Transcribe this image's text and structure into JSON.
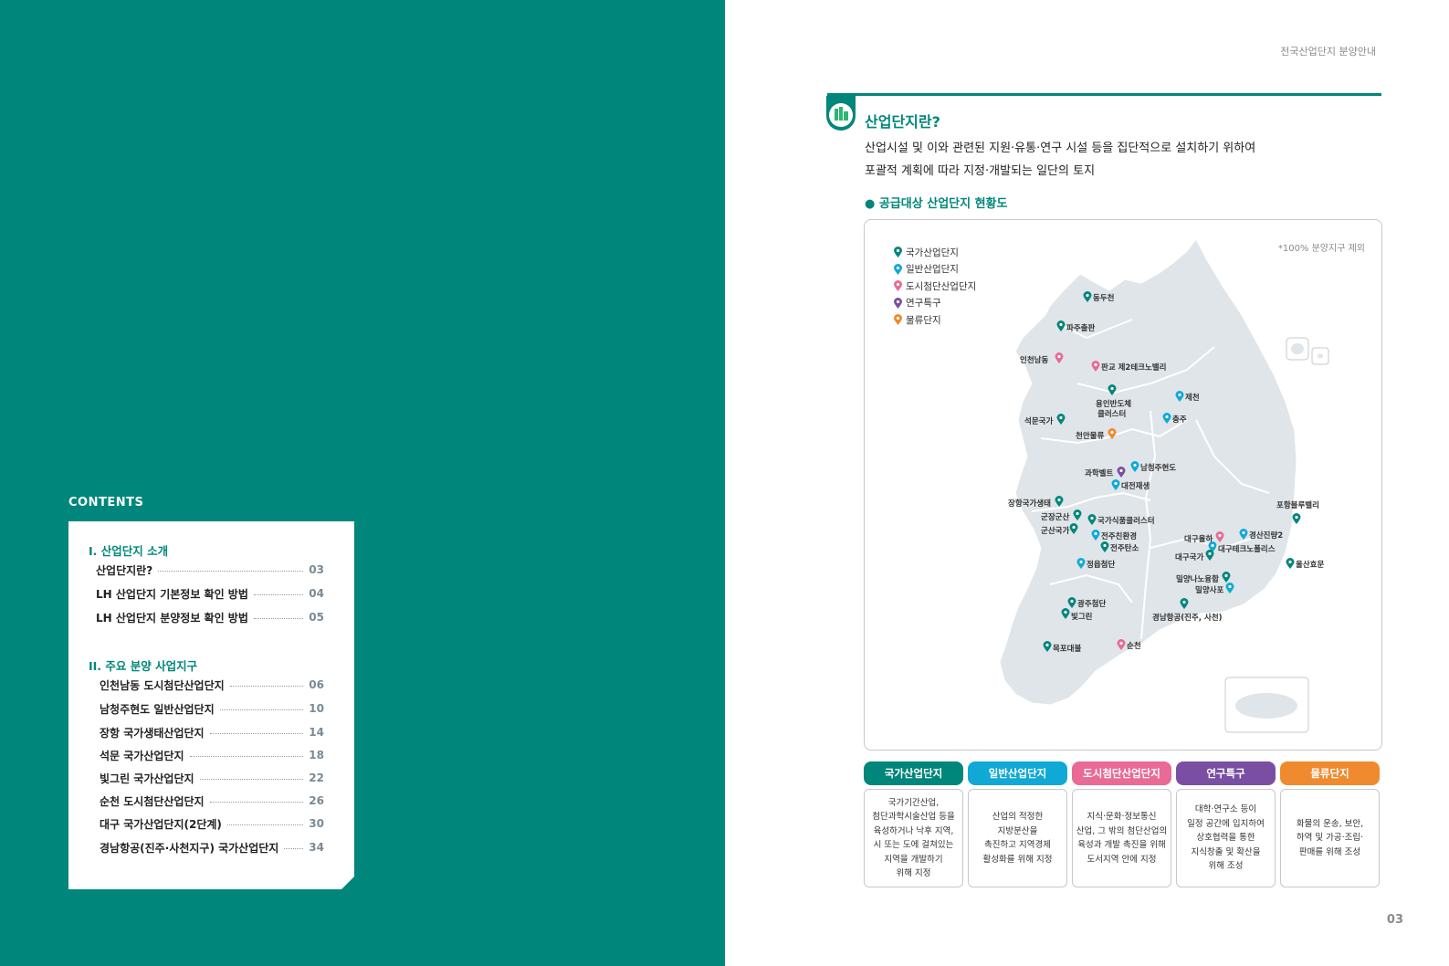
{
  "left": {
    "contents_label": "CONTENTS",
    "sections": [
      {
        "title": "I. 산업단지 소개",
        "items": [
          {
            "label": "산업단지란?",
            "page": "03"
          },
          {
            "label": "LH 산업단지 기본정보 확인 방법",
            "page": "04"
          },
          {
            "label": "LH 산업단지 분양정보 확인 방법",
            "page": "05"
          }
        ]
      },
      {
        "title": "II. 주요 분양 사업지구",
        "items": [
          {
            "label": "인천남동 도시첨단산업단지",
            "page": "06"
          },
          {
            "label": "남청주현도 일반산업단지",
            "page": "10"
          },
          {
            "label": "장항 국가생태산업단지",
            "page": "14"
          },
          {
            "label": "석문 국가산업단지",
            "page": "18"
          },
          {
            "label": "빛그린 국가산업단지",
            "page": "22"
          },
          {
            "label": "순천 도시첨단산업단지",
            "page": "26"
          },
          {
            "label": "대구 국가산업단지(2단계)",
            "page": "30"
          },
          {
            "label": "경남항공(진주·사천지구) 국가산업단지",
            "page": "34"
          }
        ]
      }
    ]
  },
  "right": {
    "running_head": "전국산업단지 분양안내",
    "page_number": "03",
    "title": "산업단지란?",
    "desc_line1": "산업시설 및 이와 관련된 지원·유통·연구 시설 등을 집단적으로 설치하기 위하여",
    "desc_line2": "포괄적 계획에 따라 지정·개발되는 일단의 토지",
    "subhead": "● 공급대상 산업단지 현황도",
    "map_note": "*100% 분양지구 제외",
    "legend": [
      {
        "label": "국가산업단지",
        "color": "#00867a"
      },
      {
        "label": "일반산업단지",
        "color": "#10a9d6"
      },
      {
        "label": "도시첨단산업단지",
        "color": "#e86a95"
      },
      {
        "label": "연구특구",
        "color": "#7a4fa3"
      },
      {
        "label": "물류단지",
        "color": "#ef8a2f"
      }
    ],
    "map_labels": {
      "m1": "동두천",
      "m2": "파주출판",
      "m3": "인천남동",
      "m4": "판교 제2테크노밸리",
      "m5a": "용인반도체",
      "m5b": "클러스터",
      "m6": "제천",
      "m7": "석문국가",
      "m8": "충주",
      "m9": "천안물류",
      "m10": "과학벨트",
      "m11": "남청주현도",
      "m12": "대전재생",
      "m13": "장항국가생태",
      "m14": "군장군산",
      "m15": "군산국가",
      "m16": "국가식품클러스터",
      "m17": "포항블루밸리",
      "m18": "전주친환경",
      "m19": "전주탄소",
      "m20": "대구율하",
      "m21": "경산진량2",
      "m22": "대구테크노폴리스",
      "m23": "대구국가",
      "m24": "정읍첨단",
      "m25": "울산효문",
      "m26": "밀양나노융합",
      "m27": "밀양사포",
      "m28": "광주첨단",
      "m29": "빛그린",
      "m30": "경남항공(진주, 사천)",
      "m31": "목포대불",
      "m32": "순천"
    },
    "categories": [
      {
        "name": "국가산업단지",
        "color": "#00867a",
        "desc": "국가기간산업,\n첨단과학시술산업 등을\n육성하거나 낙후 지역,\n시 또는 도에 걸쳐있는\n지역을 개발하기\n위해 지정"
      },
      {
        "name": "일반산업단지",
        "color": "#10a9d6",
        "desc": "산업의 적정한\n지방분산을\n촉진하고 지역경제\n활성화를 위해 지정"
      },
      {
        "name": "도시첨단산업단지",
        "color": "#e86a95",
        "desc": "지식·문화·정보통신\n산업, 그 밖의 첨단산업의\n육성과 개발 촉진을 위해\n도서지역 안에 지정"
      },
      {
        "name": "연구특구",
        "color": "#7a4fa3",
        "desc": "대학·연구소 등이\n일정 공간에 입지하여\n상호협력을 통한\n지식창출 및 확산을\n위해 조성"
      },
      {
        "name": "물류단지",
        "color": "#ef8a2f",
        "desc": "화물의 운송, 보안,\n하역 및 가공·조립·\n판매를 위해 조성"
      }
    ]
  }
}
